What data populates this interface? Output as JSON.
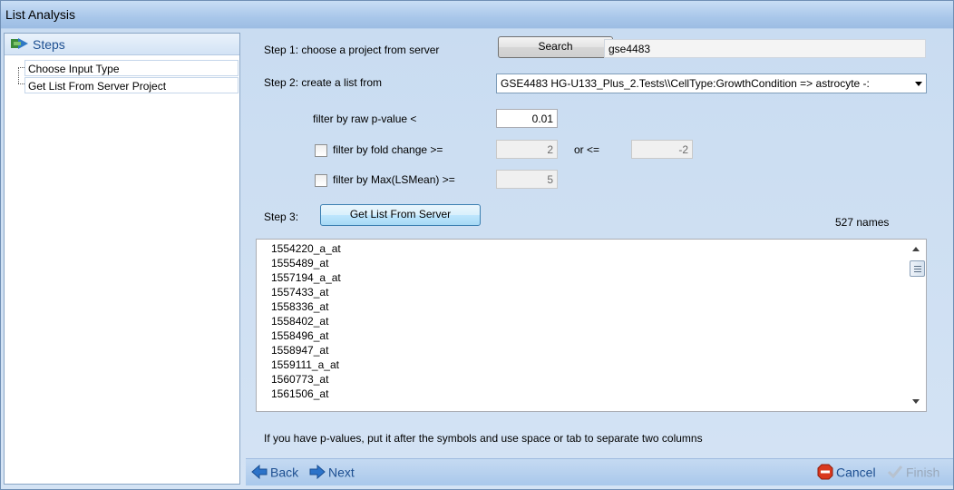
{
  "window": {
    "title": "List Analysis"
  },
  "steps": {
    "header": "Steps",
    "items": [
      {
        "label": "Choose Input Type"
      },
      {
        "label": "Get List From Server Project"
      }
    ]
  },
  "step1": {
    "label": "Step 1: choose a project from server",
    "search_button": "Search",
    "project_value": "gse4483"
  },
  "step2": {
    "label": "Step 2: create a list from",
    "selected_test": "GSE4483 HG-U133_Plus_2.Tests\\\\CellType:GrowthCondition => astrocyte -:",
    "pvalue_label": "filter by raw p-value <",
    "pvalue_value": "0.01",
    "fold_label": "filter by fold change >=",
    "fold_value": "2",
    "or_label": "or <=",
    "fold_neg_value": "-2",
    "lsmean_label": "filter by Max(LSMean) >=",
    "lsmean_value": "5"
  },
  "step3": {
    "label": "Step 3:",
    "get_list_button": "Get List From Server",
    "count_label": "527 names",
    "names": [
      "1554220_a_at",
      "1555489_at",
      "1557194_a_at",
      "1557433_at",
      "1558336_at",
      "1558402_at",
      "1558496_at",
      "1558947_at",
      "1559111_a_at",
      "1560773_at",
      "1561506_at"
    ]
  },
  "hint": "If you have p-values, put it after the symbols and use space or tab to separate two columns",
  "nav": {
    "back": "Back",
    "next": "Next",
    "cancel": "Cancel",
    "finish": "Finish"
  },
  "colors": {
    "accent": "#1d4f91",
    "titlebar": "#a9c7ea",
    "cancel_icon": "#d9381e"
  }
}
